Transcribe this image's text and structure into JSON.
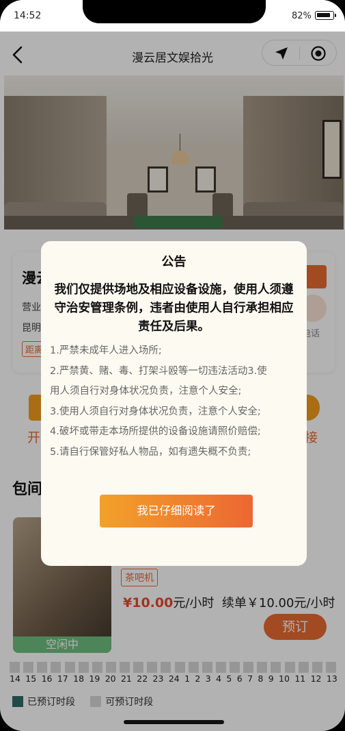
{
  "status_bar": {
    "time": "14:52",
    "battery": "82%"
  },
  "nav": {
    "title": "漫云居文娱拾光"
  },
  "shop": {
    "name_partial": "漫云",
    "hours_partial": "营业",
    "address_partial": "昆明",
    "distance_partial": "距离",
    "phone_label": "电话"
  },
  "actions": {
    "left_label_partial": "开",
    "right_label_partial": "接"
  },
  "rooms": {
    "section_title_partial": "包间",
    "items": [
      {
        "status": "空闲中",
        "tag": "茶吧机",
        "price_prefix": "¥",
        "price": "10.00",
        "price_unit": "元/小时",
        "renew": "续单￥10.00元/小时",
        "book_label": "预订"
      }
    ]
  },
  "timeline": {
    "hours": [
      "14",
      "15",
      "16",
      "17",
      "18",
      "19",
      "20",
      "21",
      "22",
      "23",
      "24",
      "1",
      "2",
      "3",
      "4",
      "5",
      "6",
      "7",
      "8",
      "9",
      "10",
      "11",
      "12",
      "13"
    ],
    "legend_booked": "已预订时段",
    "legend_available": "可预订时段",
    "booked_color": "#2e6b63",
    "available_color": "#d7d7d7"
  },
  "modal": {
    "title": "公告",
    "headline": "我们仅提供场地及相应设备设施，使用人须遵守治安管理条例，违者由使用人自行承担相应责任及后果。",
    "rules": [
      "1.严禁未成年人进入场所;",
      "2.严禁黄、赌、毒、打架斗殴等一切违法活动3.使",
      "用人须自行对身体状况负责，注意个人安全;",
      "3.使用人须自行对身体状况负责，注意个人安全;",
      "4.破坏或带走本场所提供的设备设施请照价赔偿;",
      "5.请自行保管好私人物品，如有遗失概不负责;"
    ],
    "confirm_label": "我已仔细阅读了"
  },
  "colors": {
    "accent": "#e86a32",
    "accent_light": "#f2a12a",
    "status_green": "#6fbf7f"
  }
}
